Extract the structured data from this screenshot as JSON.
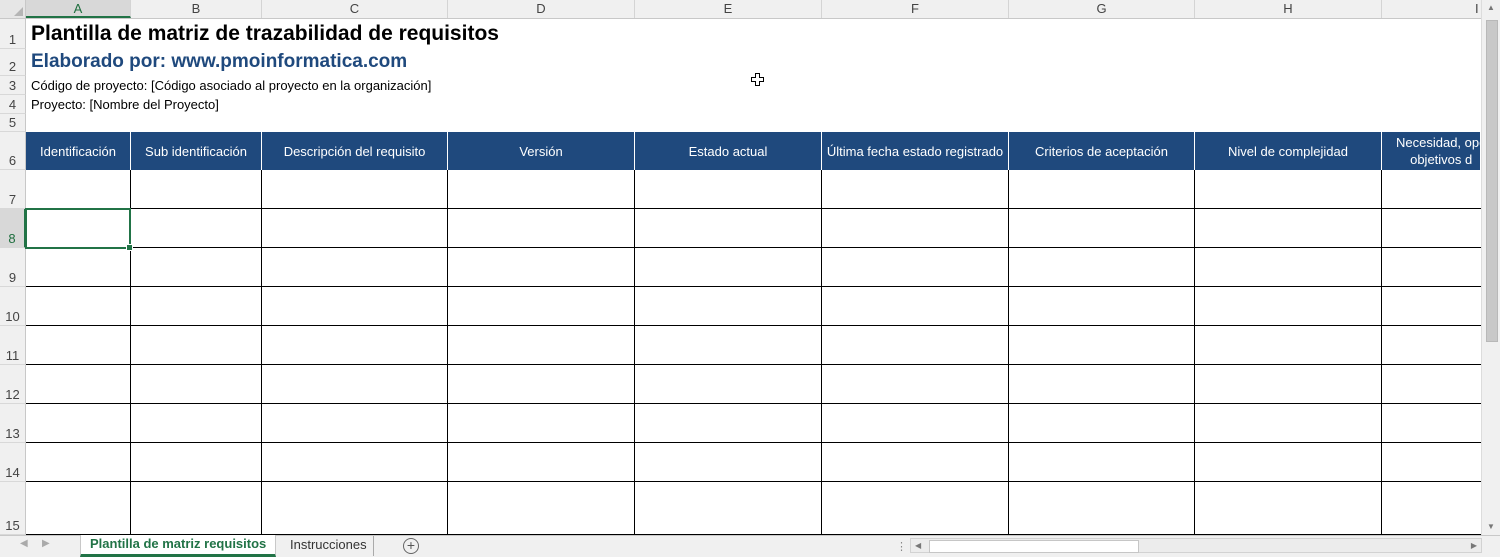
{
  "columns": [
    "A",
    "B",
    "C",
    "D",
    "E",
    "F",
    "G",
    "H",
    "I"
  ],
  "active_column": "A",
  "rows": [
    "1",
    "2",
    "3",
    "4",
    "5",
    "6",
    "7",
    "8",
    "9",
    "10",
    "11",
    "12",
    "13",
    "14",
    "15"
  ],
  "active_row": "8",
  "sheet_title": "Plantilla de matriz de trazabilidad de requisitos",
  "author_line": "Elaborado por: www.pmoinformatica.com",
  "project_code_line": "Código de proyecto: [Código asociado al proyecto en la organización]",
  "project_name_line": "Proyecto: [Nombre del Proyecto]",
  "table_headers": [
    "Identificación",
    "Sub identificación",
    "Descripción del requisito",
    "Versión",
    "Estado actual",
    "Última fecha estado registrado",
    "Criterios de aceptación",
    "Nivel de complejidad",
    "Necesidad, ope\nobjetivos d"
  ],
  "sheet_tabs": {
    "active": "Plantilla de matriz requisitos",
    "other": "Instrucciones"
  },
  "colors": {
    "header_fill": "#1f497d",
    "author_text": "#1f497d",
    "excel_green": "#217346"
  },
  "icons": {
    "cursor": "cross-cursor-icon",
    "add_sheet": "plus-circle-icon",
    "nav_prev": "chevron-left-icon",
    "nav_next": "chevron-right-icon"
  }
}
